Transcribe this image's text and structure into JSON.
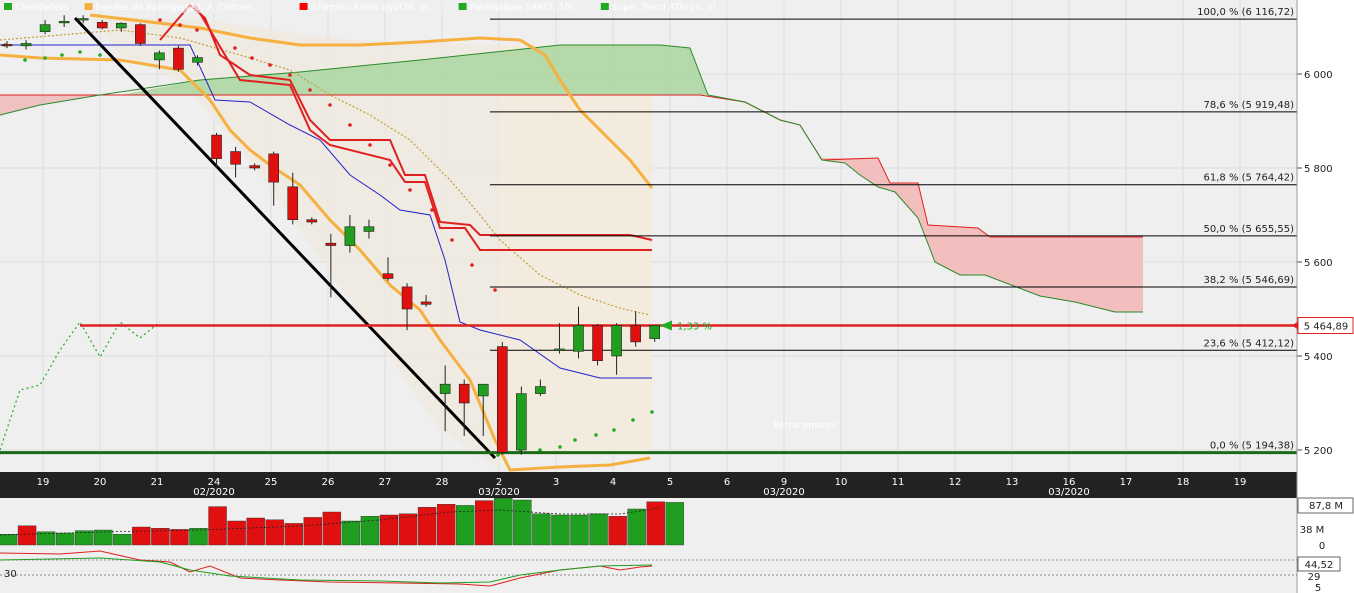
{
  "chart_data": {
    "type": "candlestick",
    "legend": [
      {
        "name": "Chandeliers",
        "color": "#22aa22"
      },
      {
        "name": "Bandes de Bollinger(20, 2, Clôture)",
        "color": "#f5b040"
      },
      {
        "name": "Ichimoku Kinko Hyo(26, 9)",
        "color": "#ff0000"
      },
      {
        "name": "Parabolique SAR(2, 10)",
        "color": "#22aa22"
      },
      {
        "name": "Super Trend ATR(10, 3)",
        "color": "#22aa22"
      }
    ],
    "y_axis": {
      "ticks": [
        5200,
        5400,
        5600,
        5800,
        6000
      ],
      "tick_labels": [
        "5 200",
        "5 400",
        "5 600",
        "5 800",
        "6 000"
      ],
      "ylim": [
        5200,
        6000
      ]
    },
    "x_axis": {
      "day_labels": [
        "19",
        "20",
        "21",
        "24",
        "25",
        "26",
        "27",
        "28",
        "2",
        "3",
        "4",
        "5",
        "6",
        "9",
        "10",
        "11",
        "12",
        "13",
        "16",
        "17",
        "18",
        "19"
      ],
      "month_labels": [
        {
          "text": "02/2020",
          "under": "24"
        },
        {
          "text": "03/2020",
          "under": "2"
        },
        {
          "text": "03/2020",
          "under": "9"
        },
        {
          "text": "03/2020",
          "under": "16"
        }
      ]
    },
    "fibonacci": [
      {
        "label": "100,0 % (6 116,72)",
        "value": 6116.72
      },
      {
        "label": "78,6 % (5 919,48)",
        "value": 5919.48
      },
      {
        "label": "61,8 % (5 764,42)",
        "value": 5764.42
      },
      {
        "label": "50,0 % (5 655,55)",
        "value": 5655.55
      },
      {
        "label": "38,2 % (5 546,69)",
        "value": 5546.69
      },
      {
        "label": "23,6 % (5 412,12)",
        "value": 5412.12
      },
      {
        "label": "0,0 % (5 194,38)",
        "value": 5194.38
      }
    ],
    "fib_caption": "Retracements",
    "last_price": {
      "label": "5 464,89",
      "value": 5464.89
    },
    "change_label": "1,33 %",
    "candles": [
      {
        "o": 6063,
        "h": 6070,
        "l": 6055,
        "c": 6060
      },
      {
        "o": 6060,
        "h": 6072,
        "l": 6052,
        "c": 6065
      },
      {
        "o": 6090,
        "h": 6115,
        "l": 6085,
        "c": 6105
      },
      {
        "o": 6110,
        "h": 6125,
        "l": 6100,
        "c": 6112
      },
      {
        "o": 6115,
        "h": 6125,
        "l": 6108,
        "c": 6118
      },
      {
        "o": 6110,
        "h": 6115,
        "l": 6095,
        "c": 6098
      },
      {
        "o": 6098,
        "h": 6110,
        "l": 6090,
        "c": 6108
      },
      {
        "o": 6105,
        "h": 6108,
        "l": 6060,
        "c": 6065
      },
      {
        "o": 6030,
        "h": 6050,
        "l": 6010,
        "c": 6045
      },
      {
        "o": 6055,
        "h": 6060,
        "l": 6005,
        "c": 6010
      },
      {
        "o": 6025,
        "h": 6040,
        "l": 6018,
        "c": 6035
      },
      {
        "o": 5870,
        "h": 5875,
        "l": 5800,
        "c": 5820
      },
      {
        "o": 5835,
        "h": 5845,
        "l": 5780,
        "c": 5808
      },
      {
        "o": 5805,
        "h": 5810,
        "l": 5795,
        "c": 5800
      },
      {
        "o": 5830,
        "h": 5835,
        "l": 5720,
        "c": 5770
      },
      {
        "o": 5760,
        "h": 5790,
        "l": 5680,
        "c": 5690
      },
      {
        "o": 5690,
        "h": 5695,
        "l": 5680,
        "c": 5685
      },
      {
        "o": 5640,
        "h": 5660,
        "l": 5525,
        "c": 5635
      },
      {
        "o": 5635,
        "h": 5700,
        "l": 5620,
        "c": 5675
      },
      {
        "o": 5665,
        "h": 5690,
        "l": 5650,
        "c": 5675
      },
      {
        "o": 5575,
        "h": 5610,
        "l": 5560,
        "c": 5565
      },
      {
        "o": 5547,
        "h": 5555,
        "l": 5455,
        "c": 5500
      },
      {
        "o": 5515,
        "h": 5530,
        "l": 5505,
        "c": 5510
      },
      {
        "o": 5320,
        "h": 5380,
        "l": 5240,
        "c": 5340
      },
      {
        "o": 5340,
        "h": 5350,
        "l": 5230,
        "c": 5300
      },
      {
        "o": 5315,
        "h": 5335,
        "l": 5230,
        "c": 5340
      },
      {
        "o": 5420,
        "h": 5430,
        "l": 5190,
        "c": 5195
      },
      {
        "o": 5200,
        "h": 5335,
        "l": 5190,
        "c": 5320
      },
      {
        "o": 5320,
        "h": 5350,
        "l": 5315,
        "c": 5335
      },
      {
        "o": 5412,
        "h": 5470,
        "l": 5405,
        "c": 5415
      },
      {
        "o": 5410,
        "h": 5505,
        "l": 5395,
        "c": 5465
      },
      {
        "o": 5465,
        "h": 5468,
        "l": 5380,
        "c": 5390
      },
      {
        "o": 5400,
        "h": 5470,
        "l": 5360,
        "c": 5465
      },
      {
        "o": 5465,
        "h": 5495,
        "l": 5420,
        "c": 5430
      },
      {
        "o": 5437,
        "h": 5465,
        "l": 5430,
        "c": 5464.89
      }
    ],
    "volume": {
      "label": "87,8 M",
      "ticks": [
        "38 M",
        "0"
      ],
      "values": [
        18,
        32,
        22,
        20,
        24,
        25,
        18,
        30,
        28,
        26,
        28,
        64,
        40,
        45,
        42,
        36,
        46,
        55,
        40,
        48,
        50,
        52,
        63,
        68,
        66,
        74,
        78,
        75,
        52,
        50,
        50,
        52,
        48,
        60,
        72,
        71
      ],
      "up": [
        true,
        false,
        true,
        true,
        true,
        true,
        true,
        false,
        false,
        false,
        true,
        false,
        false,
        false,
        false,
        false,
        false,
        false,
        true,
        true,
        false,
        false,
        false,
        false,
        true,
        false,
        true,
        true,
        true,
        true,
        true,
        true,
        false,
        true,
        false,
        true
      ]
    },
    "oscillator": {
      "value_label": "44,52",
      "left_label": "30",
      "ticks": [
        "29",
        "5"
      ]
    }
  }
}
